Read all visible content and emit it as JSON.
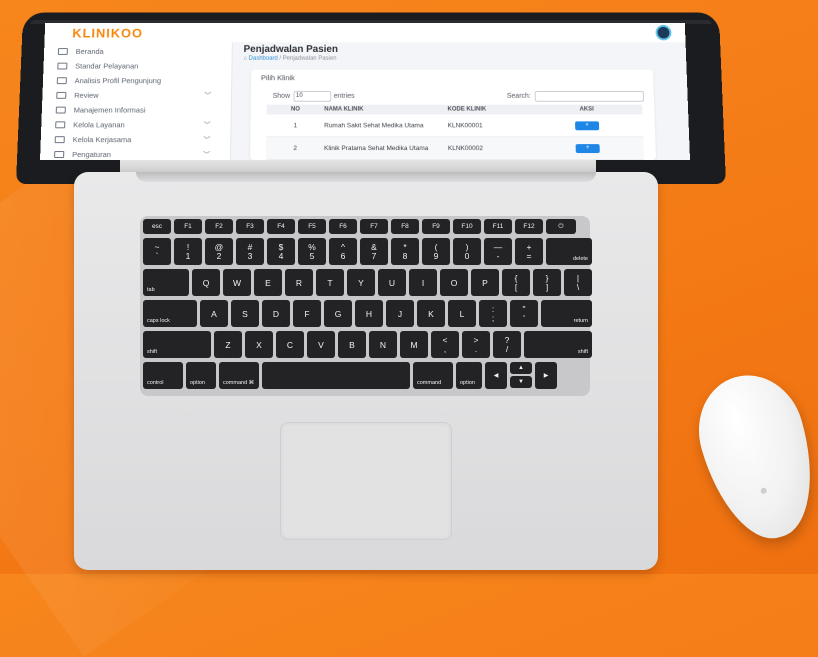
{
  "app": {
    "logo_text": "KLINIKOO",
    "accent_color": "#f5870f",
    "avatar_icon": "user-avatar"
  },
  "sidebar": {
    "items": [
      {
        "label": "Beranda",
        "icon": "home-icon",
        "has_chevron": false
      },
      {
        "label": "Standar Pelayanan",
        "icon": "book-icon",
        "has_chevron": false
      },
      {
        "label": "Analisis Profil Pengunjung",
        "icon": "chart-icon",
        "has_chevron": false
      },
      {
        "label": "Review",
        "icon": "list-icon",
        "has_chevron": true
      },
      {
        "label": "Manajemen Informasi",
        "icon": "info-icon",
        "has_chevron": false
      },
      {
        "label": "Kelola Layanan",
        "icon": "clinic-icon",
        "has_chevron": true
      },
      {
        "label": "Kelola Kerjasama",
        "icon": "handshake-icon",
        "has_chevron": true
      },
      {
        "label": "Pengaturan",
        "icon": "gear-icon",
        "has_chevron": true
      }
    ]
  },
  "main": {
    "page_title": "Penjadwalan Pasien",
    "breadcrumb_link": "Dashboard",
    "breadcrumb_current": "/ Penjadwalan Pasien",
    "card_title": "Pilih Klinik",
    "show_label": "Show",
    "entries_value": "10",
    "entries_suffix": "entries",
    "search_label": "Search:",
    "table": {
      "headers": [
        "NO",
        "NAMA KLINIK",
        "KODE KLINIK",
        "AKSI"
      ],
      "rows": [
        {
          "no": "1",
          "nama": "Rumah Sakit Sehat Medika Utama",
          "kode": "KLNK00001",
          "aksi": "+"
        },
        {
          "no": "2",
          "nama": "Klinik Pratama Sehat Medika Utama",
          "kode": "KLNK00002",
          "aksi": "+"
        }
      ]
    }
  },
  "keyboard": {
    "fn_row": [
      "esc",
      "F1",
      "F2",
      "F3",
      "F4",
      "F5",
      "F6",
      "F7",
      "F8",
      "F9",
      "F10",
      "F11",
      "F12",
      "⏻"
    ],
    "num_row": [
      [
        "~",
        "`"
      ],
      [
        "!",
        "1"
      ],
      [
        "@",
        "2"
      ],
      [
        "#",
        "3"
      ],
      [
        "$",
        "4"
      ],
      [
        "%",
        "5"
      ],
      [
        "^",
        "6"
      ],
      [
        "&",
        "7"
      ],
      [
        "*",
        "8"
      ],
      [
        "(",
        "9"
      ],
      [
        ")",
        "0"
      ],
      [
        "—",
        "-"
      ],
      [
        "+",
        "="
      ]
    ],
    "delete": "delete",
    "tab": "tab",
    "qwerty": [
      "Q",
      "W",
      "E",
      "R",
      "T",
      "Y",
      "U",
      "I",
      "O",
      "P"
    ],
    "bracket_keys": [
      [
        "{",
        "["
      ],
      [
        "}",
        "]"
      ],
      [
        "|",
        "\\"
      ]
    ],
    "caps": "caps lock",
    "asdf": [
      "A",
      "S",
      "D",
      "F",
      "G",
      "H",
      "J",
      "K",
      "L"
    ],
    "semi_keys": [
      [
        ":",
        ";"
      ],
      [
        "\"",
        "'"
      ]
    ],
    "return": "return",
    "shift": "shift",
    "zxcv": [
      "Z",
      "X",
      "C",
      "V",
      "B",
      "N",
      "M"
    ],
    "comma_keys": [
      [
        "<",
        ","
      ],
      [
        ">",
        "."
      ],
      [
        "?",
        "/"
      ]
    ],
    "control": "control",
    "option": "option",
    "command_left": "command ⌘",
    "command_right": "command",
    "alt_symbol": "alt",
    "arrows": [
      "◀",
      "▲",
      "▼",
      "▶"
    ]
  }
}
